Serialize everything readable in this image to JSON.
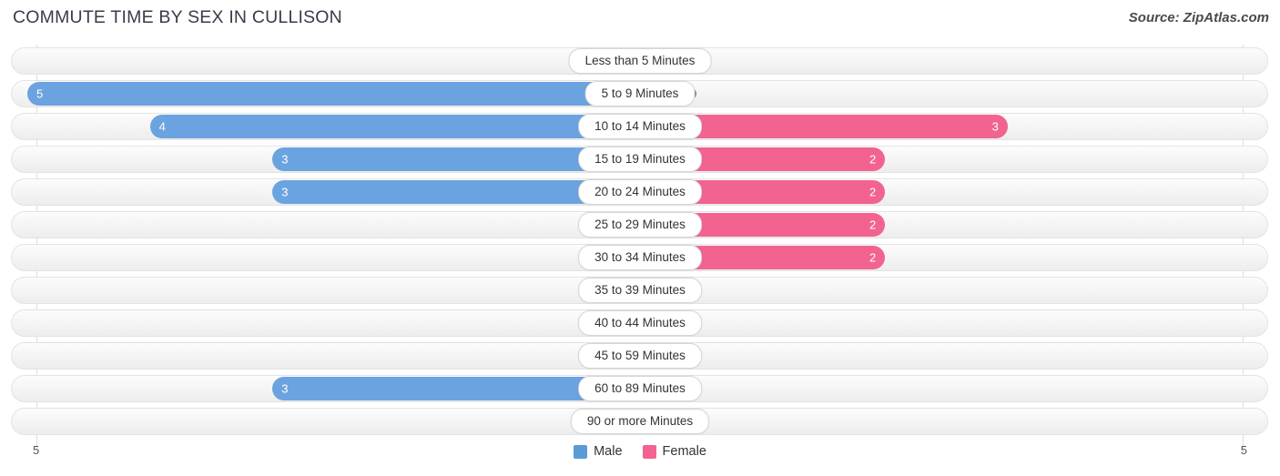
{
  "header": {
    "title": "COMMUTE TIME BY SEX IN CULLISON",
    "source": "Source: ZipAtlas.com"
  },
  "legend": {
    "items": [
      {
        "label": "Male",
        "color": "#5b9bd5"
      },
      {
        "label": "Female",
        "color": "#f2638f"
      }
    ]
  },
  "axis": {
    "left_end": "5",
    "right_end": "5"
  },
  "colors": {
    "male": "#6ba3e0",
    "male_zero": "#aecbee",
    "female": "#f2638f",
    "female_zero": "#f8a8c4",
    "track": "#f4f4f4",
    "gridline": "#dddddd"
  },
  "chart_data": {
    "type": "bar",
    "title": "COMMUTE TIME BY SEX IN CULLISON",
    "subtitle": "Source: ZipAtlas.com",
    "orientation": "horizontal",
    "style": "diverging-bidirectional",
    "xlabel": "",
    "ylabel": "",
    "xlim": [
      5,
      5
    ],
    "grid": true,
    "legend_position": "bottom-center",
    "categories": [
      "Less than 5 Minutes",
      "5 to 9 Minutes",
      "10 to 14 Minutes",
      "15 to 19 Minutes",
      "20 to 24 Minutes",
      "25 to 29 Minutes",
      "30 to 34 Minutes",
      "35 to 39 Minutes",
      "40 to 44 Minutes",
      "45 to 59 Minutes",
      "60 to 89 Minutes",
      "90 or more Minutes"
    ],
    "series": [
      {
        "name": "Male",
        "values": [
          0,
          5,
          4,
          3,
          3,
          0,
          0,
          0,
          0,
          0,
          3,
          0
        ]
      },
      {
        "name": "Female",
        "values": [
          0,
          0,
          3,
          2,
          2,
          2,
          2,
          0,
          0,
          0,
          0,
          0
        ]
      }
    ]
  },
  "rows": [
    {
      "label": "Less than 5 Minutes",
      "male": "0",
      "female": "0"
    },
    {
      "label": "5 to 9 Minutes",
      "male": "5",
      "female": "0"
    },
    {
      "label": "10 to 14 Minutes",
      "male": "4",
      "female": "3"
    },
    {
      "label": "15 to 19 Minutes",
      "male": "3",
      "female": "2"
    },
    {
      "label": "20 to 24 Minutes",
      "male": "3",
      "female": "2"
    },
    {
      "label": "25 to 29 Minutes",
      "male": "0",
      "female": "2"
    },
    {
      "label": "30 to 34 Minutes",
      "male": "0",
      "female": "2"
    },
    {
      "label": "35 to 39 Minutes",
      "male": "0",
      "female": "0"
    },
    {
      "label": "40 to 44 Minutes",
      "male": "0",
      "female": "0"
    },
    {
      "label": "45 to 59 Minutes",
      "male": "0",
      "female": "0"
    },
    {
      "label": "60 to 89 Minutes",
      "male": "3",
      "female": "0"
    },
    {
      "label": "90 or more Minutes",
      "male": "0",
      "female": "0"
    }
  ]
}
